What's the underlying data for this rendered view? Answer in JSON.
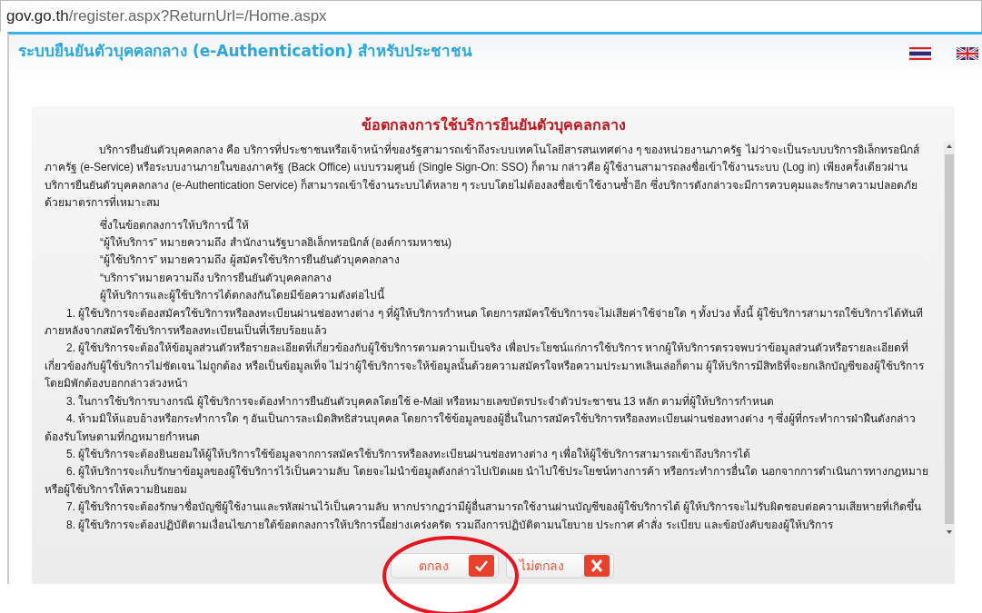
{
  "address_bar": {
    "host": "gov.go.th",
    "path": "/register.aspx?ReturnUrl=/Home.aspx"
  },
  "header": {
    "title": "ระบบยืนยันตัวบุคคลกลาง (e-Authentication) สำหรับประชาชน",
    "languages": [
      {
        "kind": "thai"
      },
      {
        "kind": "english"
      }
    ]
  },
  "agreement": {
    "title": "ข้อตกลงการใช้บริการยืนยันตัวบุคคลกลาง",
    "paragraphs": [
      {
        "kind": "intro",
        "text": "บริการยืนยันตัวบุคคลกลาง คือ บริการที่ประชาชนหรือเจ้าหน้าที่ของรัฐสามารถเข้าถึงระบบเทคโนโลยีสารสนเทศต่าง ๆ ของหน่วยงานภาครัฐ ไม่ว่าจะเป็นระบบบริการอิเล็กทรอนิกส์ภาครัฐ (e-Service) หรือระบบงานภายในของภาครัฐ (Back Office) แบบรวมศูนย์ (Single Sign-On: SSO) ก็ตาม กล่าวคือ ผู้ใช้งานสามารถลงชื่อเข้าใช้งานระบบ (Log in) เพียงครั้งเดียวผ่านบริการยืนยันตัวบุคคลกลาง (e-Authentication Service) ก็สามารถเข้าใช้งานระบบได้หลาย ๆ ระบบโดยไม่ต้องลงชื่อเข้าใช้งานซ้ำอีก ซึ่งบริการดังกล่าวจะมีการควบคุมและรักษาความปลอดภัยด้วยมาตรการที่เหมาะสม"
      },
      {
        "kind": "definition",
        "text": "ซึ่งในข้อตกลงการให้บริการนี้ ให้"
      },
      {
        "kind": "definition",
        "text": "“ผู้ให้บริการ” หมายความถึง สำนักงานรัฐบาลอิเล็กทรอนิกส์ (องค์การมหาชน)"
      },
      {
        "kind": "definition",
        "text": "“ผู้ใช้บริการ” หมายความถึง ผู้สมัครใช้บริการยืนยันตัวบุคคลกลาง"
      },
      {
        "kind": "definition",
        "text": "“บริการ”หมายความถึง บริการยืนยันตัวบุคคลกลาง"
      },
      {
        "kind": "definition",
        "text": "ผู้ให้บริการและผู้ใช้บริการได้ตกลงกันโดยมีข้อความดังต่อไปนี้"
      },
      {
        "kind": "clause",
        "text": "1. ผู้ใช้บริการจะต้องสมัครใช้บริการหรือลงทะเบียนผ่านช่องทางต่าง ๆ ที่ผู้ให้บริการกำหนด โดยการสมัครใช้บริการจะไม่เสียค่าใช้จ่ายใด ๆ ทั้งปวง ทั้งนี้ ผู้ใช้บริการสามารถใช้บริการได้ทันทีภายหลังจากสมัครใช้บริการหรือลงทะเบียนเป็นที่เรียบร้อยแล้ว"
      },
      {
        "kind": "clause",
        "text": "2. ผู้ใช้บริการจะต้องให้ข้อมูลส่วนตัวหรือรายละเอียดที่เกี่ยวข้องกับผู้ใช้บริการตามความเป็นจริง เพื่อประโยชน์แก่การใช้บริการ หากผู้ให้บริการตรวจพบว่าข้อมูลส่วนตัวหรือรายละเอียดที่เกี่ยวข้องกับผู้ใช้บริการไม่ชัดเจน ไม่ถูกต้อง หรือเป็นข้อมูลเท็จ ไม่ว่าผู้ใช้บริการจะให้ข้อมูลนั้นด้วยความสมัครใจหรือความประมาทเลินเล่อก็ตาม ผู้ให้บริการมีสิทธิที่จะยกเลิกบัญชีของผู้ใช้บริการโดยมิพักต้องบอกกล่าวล่วงหน้า"
      },
      {
        "kind": "clause",
        "text": "3. ในการใช้บริการบางกรณี ผู้ใช้บริการจะต้องทำการยืนยันตัวบุคคลโดยใช้ e-Mail หรือหมายเลขบัตรประจำตัวประชาชน 13 หลัก ตามที่ผู้ให้บริการกำหนด"
      },
      {
        "kind": "clause",
        "text": "4. ห้ามมิให้แอบอ้างหรือกระทำการใด ๆ อันเป็นการละเมิดสิทธิส่วนบุคคล โดยการใช้ข้อมูลของผู้อื่นในการสมัครใช้บริการหรือลงทะเบียนผ่านช่องทางต่าง ๆ ซึ่งผู้ที่กระทำการฝ่าฝืนดังกล่าว ต้องรับโทษตามที่กฎหมายกำหนด"
      },
      {
        "kind": "clause",
        "text": "5. ผู้ใช้บริการจะต้องยินยอมให้ผู้ให้บริการใช้ข้อมูลจากการสมัครใช้บริการหรือลงทะเบียนผ่านช่องทางต่าง ๆ เพื่อให้ผู้ใช้บริการสามารถเข้าถึงบริการได้"
      },
      {
        "kind": "clause",
        "text": "6. ผู้ให้บริการจะเก็บรักษาข้อมูลของผู้ใช้บริการไว้เป็นความลับ โดยจะไม่นำข้อมูลดังกล่าวไปเปิดเผย นำไปใช้ประโยชน์ทางการค้า หรือกระทำการอื่นใด นอกจากการดำเนินการทางกฎหมายหรือผู้ใช้บริการให้ความยินยอม"
      },
      {
        "kind": "clause",
        "text": "7. ผู้ใช้บริการจะต้องรักษาชื่อบัญชีผู้ใช้งานและรหัสผ่านไว้เป็นความลับ หากปรากฏว่ามีผู้อื่นสามารถใช้งานผ่านบัญชีของผู้ใช้บริการได้ ผู้ให้บริการจะไม่รับผิดชอบต่อความเสียหายที่เกิดขึ้น"
      },
      {
        "kind": "clause",
        "text": "8. ผู้ใช้บริการจะต้องปฏิบัติตามเงื่อนไขภายใต้ข้อตกลงการให้บริการนี้อย่างเคร่งครัด รวมถึงการปฏิบัติตามนโยบาย ประกาศ คำสั่ง ระเบียบ และข้อบังคับของผู้ให้บริการ"
      }
    ]
  },
  "buttons": [
    {
      "kind": "accept",
      "label": "ตกลง"
    },
    {
      "kind": "decline",
      "label": "ไม่ตกลง"
    }
  ],
  "annotation": {
    "kind": "ellipse"
  }
}
